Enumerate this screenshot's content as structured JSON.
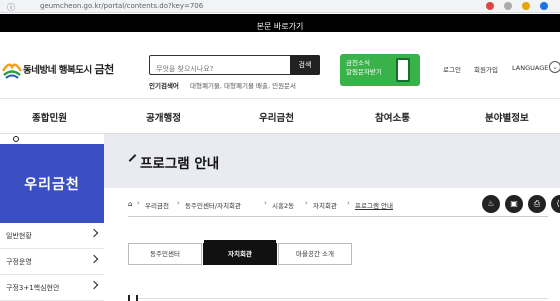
{
  "browser": {
    "url": "geumcheon.go.kr/portal/contents.do?key=706",
    "url_icon": "info-icon"
  },
  "skip_link": "본문 바로가기",
  "header": {
    "logo_text": "동네방네 행복도시",
    "logo_city": "금천",
    "search_placeholder": "무엇을 찾으시나요?",
    "search_button": "검색",
    "popular_label": "인기검색어",
    "popular_terms": "대형폐기물, 대형폐기물 배출, 민원문서",
    "banner_line1": "금천소식",
    "banner_line2": "알림문자받기",
    "login": "로그인",
    "signup": "회원가입",
    "language": "LANGUAGE"
  },
  "nav": {
    "items": [
      "종합민원",
      "공개행정",
      "우리금천",
      "참여소통",
      "분야별정보"
    ]
  },
  "sidebar": {
    "title": "우리금천",
    "items": [
      "일반현황",
      "구정운영",
      "구정3+1핵심현안"
    ]
  },
  "main": {
    "page_title": "프로그램 안내",
    "breadcrumb": [
      "우리금천",
      "동주민센터/자치회관",
      "시흥2동",
      "자치회관",
      "프로그램 안내"
    ],
    "tools": [
      "like-icon",
      "bookmark-icon",
      "print-icon",
      "share-icon"
    ],
    "tabs": [
      {
        "label": "동주민센터",
        "active": false
      },
      {
        "label": "자치회관",
        "active": true
      },
      {
        "label": "마을공간 소개",
        "active": false
      }
    ]
  },
  "colors": {
    "sidebar_accent": "#3a4fc4",
    "banner_green": "#39b24a",
    "title_band": "#e9ebf1"
  }
}
